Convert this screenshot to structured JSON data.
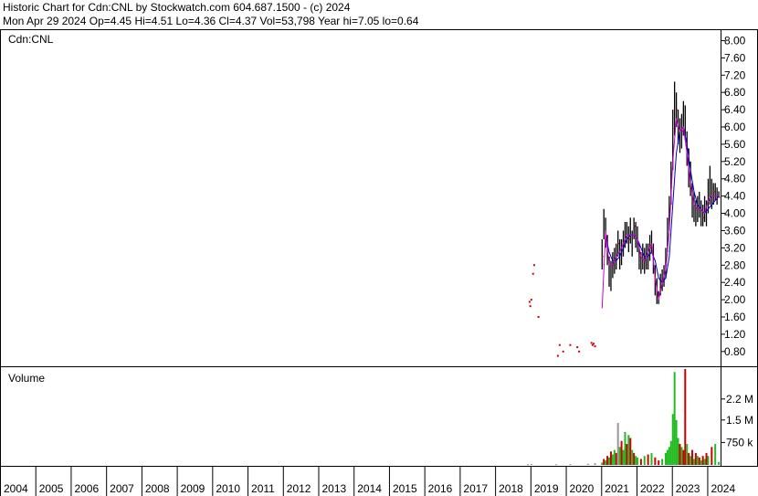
{
  "header": {
    "line1": "Historic Chart for Cdn:CNL by Stockwatch.com 604.687.1500 - (c) 2024",
    "line2": "Mon Apr 29 2024  Op=4.45  Hi=4.51  Lo=4.36  Cl=4.37  Vol=53,798  Year hi=7.05  lo=0.64"
  },
  "colors": {
    "price_bar": "#000000",
    "price_sparse": "#cc0000",
    "ma_short": "#cc00cc",
    "ma_long": "#0000cc",
    "vol_up": "#22bb22",
    "vol_down": "#cc0000",
    "vol_flat": "#999999",
    "grid": "#000000"
  },
  "chart_data": [
    {
      "type": "line",
      "title": "Cdn:CNL",
      "ylim": [
        0.5,
        8.2
      ],
      "y_ticks": [
        "8.00",
        "7.60",
        "7.20",
        "6.80",
        "6.40",
        "6.00",
        "5.60",
        "5.20",
        "4.80",
        "4.40",
        "4.00",
        "3.60",
        "3.20",
        "2.80",
        "2.40",
        "2.00",
        "1.60",
        "1.20",
        "0.80"
      ],
      "sparse_points": {
        "x": [
          2018.95,
          2018.97,
          2019.0,
          2019.05,
          2019.08,
          2019.2,
          2019.75,
          2019.8,
          2019.9,
          2020.1,
          2020.3,
          2020.35,
          2020.7,
          2020.73,
          2020.76,
          2020.8
        ],
        "y": [
          1.95,
          1.85,
          2.0,
          2.6,
          2.8,
          1.6,
          0.7,
          0.95,
          0.8,
          0.95,
          0.9,
          0.8,
          1.0,
          0.95,
          0.98,
          0.92
        ]
      },
      "price_series": {
        "x": [
          2021.0,
          2021.05,
          2021.1,
          2021.15,
          2021.2,
          2021.25,
          2021.3,
          2021.35,
          2021.4,
          2021.45,
          2021.5,
          2021.55,
          2021.6,
          2021.65,
          2021.7,
          2021.75,
          2021.8,
          2021.85,
          2021.9,
          2021.95,
          2022.0,
          2022.05,
          2022.1,
          2022.15,
          2022.2,
          2022.25,
          2022.3,
          2022.35,
          2022.4,
          2022.45,
          2022.5,
          2022.55,
          2022.6,
          2022.65,
          2022.7,
          2022.75,
          2022.8,
          2022.85,
          2022.9,
          2022.95,
          2023.0,
          2023.05,
          2023.1,
          2023.15,
          2023.2,
          2023.25,
          2023.3,
          2023.35,
          2023.4,
          2023.45,
          2023.5,
          2023.55,
          2023.6,
          2023.65,
          2023.7,
          2023.75,
          2023.8,
          2023.85,
          2023.9,
          2023.95,
          2024.0,
          2024.05,
          2024.1,
          2024.15,
          2024.2,
          2024.25,
          2024.3
        ],
        "close": [
          3.0,
          3.8,
          3.6,
          3.1,
          2.6,
          2.5,
          2.8,
          2.9,
          3.0,
          3.3,
          3.0,
          3.1,
          3.3,
          3.5,
          3.6,
          3.4,
          3.6,
          3.3,
          3.7,
          3.5,
          3.4,
          3.0,
          2.9,
          3.0,
          2.9,
          3.0,
          3.0,
          3.2,
          3.4,
          2.9,
          2.4,
          2.2,
          2.0,
          2.4,
          2.5,
          2.5,
          2.8,
          3.5,
          4.0,
          4.6,
          5.6,
          6.2,
          6.4,
          6.0,
          5.8,
          5.9,
          6.2,
          6.1,
          5.5,
          5.0,
          4.8,
          4.3,
          4.2,
          4.0,
          4.1,
          4.2,
          4.0,
          3.9,
          4.1,
          4.0,
          4.3,
          4.6,
          4.4,
          4.5,
          4.5,
          4.4,
          4.37
        ],
        "high": [
          3.4,
          4.1,
          3.9,
          3.5,
          3.0,
          2.9,
          3.1,
          3.2,
          3.3,
          3.6,
          3.4,
          3.4,
          3.6,
          3.8,
          3.8,
          3.7,
          3.9,
          3.6,
          3.9,
          3.8,
          3.7,
          3.3,
          3.1,
          3.3,
          3.2,
          3.3,
          3.3,
          3.5,
          3.6,
          3.3,
          2.8,
          2.5,
          2.2,
          2.6,
          2.7,
          2.8,
          3.2,
          3.9,
          4.4,
          5.2,
          6.4,
          7.05,
          6.8,
          6.4,
          6.2,
          6.3,
          6.6,
          6.5,
          5.9,
          5.5,
          5.2,
          4.7,
          4.5,
          4.3,
          4.4,
          4.5,
          4.3,
          4.2,
          4.4,
          4.3,
          4.8,
          5.1,
          4.8,
          4.7,
          4.7,
          4.6,
          4.51
        ],
        "low": [
          2.7,
          3.4,
          3.2,
          2.8,
          2.3,
          2.2,
          2.5,
          2.6,
          2.7,
          3.0,
          2.7,
          2.8,
          3.0,
          3.2,
          3.3,
          3.1,
          3.3,
          3.0,
          3.4,
          3.2,
          3.1,
          2.7,
          2.6,
          2.7,
          2.6,
          2.7,
          2.7,
          2.9,
          3.1,
          2.6,
          2.1,
          1.9,
          1.9,
          2.1,
          2.2,
          2.3,
          2.5,
          3.1,
          3.6,
          4.2,
          5.0,
          5.8,
          6.0,
          5.6,
          5.4,
          5.5,
          5.8,
          5.7,
          5.1,
          4.6,
          4.4,
          3.9,
          3.8,
          3.7,
          3.8,
          3.9,
          3.7,
          3.7,
          3.8,
          3.7,
          4.0,
          4.2,
          4.1,
          4.2,
          4.3,
          4.2,
          4.36
        ]
      },
      "ma_short": {
        "x": [
          2021.0,
          2021.1,
          2021.2,
          2021.3,
          2021.4,
          2021.5,
          2021.6,
          2021.7,
          2021.8,
          2021.9,
          2022.0,
          2022.1,
          2022.2,
          2022.3,
          2022.4,
          2022.5,
          2022.6,
          2022.7,
          2022.8,
          2022.9,
          2023.0,
          2023.1,
          2023.2,
          2023.3,
          2023.4,
          2023.5,
          2023.6,
          2023.7,
          2023.8,
          2023.9,
          2024.0,
          2024.1,
          2024.2,
          2024.3
        ],
        "y": [
          1.8,
          3.6,
          2.8,
          2.8,
          3.0,
          3.1,
          3.3,
          3.5,
          3.5,
          3.5,
          3.4,
          3.0,
          2.9,
          3.1,
          3.3,
          2.5,
          2.0,
          2.4,
          2.7,
          3.6,
          5.2,
          6.2,
          5.9,
          6.0,
          5.4,
          4.7,
          4.2,
          4.1,
          4.1,
          4.0,
          4.3,
          4.4,
          4.4,
          4.4
        ]
      },
      "ma_long": {
        "x": [
          2021.1,
          2021.2,
          2021.3,
          2021.4,
          2021.5,
          2021.6,
          2021.7,
          2021.8,
          2021.9,
          2022.0,
          2022.1,
          2022.2,
          2022.3,
          2022.4,
          2022.5,
          2022.6,
          2022.7,
          2022.8,
          2022.9,
          2023.0,
          2023.1,
          2023.2,
          2023.3,
          2023.4,
          2023.5,
          2023.6,
          2023.7,
          2023.8,
          2023.9,
          2024.0,
          2024.1,
          2024.2,
          2024.3
        ],
        "y": [
          3.5,
          3.1,
          2.9,
          2.9,
          3.0,
          3.2,
          3.4,
          3.5,
          3.5,
          3.4,
          3.2,
          3.0,
          3.0,
          3.1,
          2.9,
          2.5,
          2.4,
          2.5,
          3.0,
          4.2,
          5.4,
          5.9,
          6.0,
          5.6,
          5.0,
          4.5,
          4.2,
          4.1,
          4.0,
          4.1,
          4.2,
          4.3,
          4.4
        ]
      }
    },
    {
      "type": "bar",
      "title": "Volume",
      "ylim": [
        0,
        3200000
      ],
      "y_ticks": [
        "2.2 M",
        "1.5 M",
        "750 k"
      ],
      "y_tick_values": [
        2200000,
        1500000,
        750000
      ],
      "x": [
        2018.9,
        2019.0,
        2019.7,
        2020.1,
        2020.6,
        2020.8,
        2021.0,
        2021.05,
        2021.1,
        2021.15,
        2021.2,
        2021.25,
        2021.3,
        2021.35,
        2021.4,
        2021.45,
        2021.5,
        2021.55,
        2021.6,
        2021.65,
        2021.7,
        2021.75,
        2021.8,
        2021.85,
        2021.9,
        2021.95,
        2022.0,
        2022.1,
        2022.2,
        2022.3,
        2022.4,
        2022.5,
        2022.6,
        2022.7,
        2022.8,
        2022.85,
        2022.9,
        2022.95,
        2023.0,
        2023.05,
        2023.1,
        2023.15,
        2023.2,
        2023.25,
        2023.3,
        2023.35,
        2023.4,
        2023.45,
        2023.5,
        2023.55,
        2023.6,
        2023.65,
        2023.7,
        2023.75,
        2023.8,
        2023.85,
        2023.9,
        2023.95,
        2024.0,
        2024.1,
        2024.2,
        2024.3
      ],
      "values": [
        20000,
        30000,
        25000,
        30000,
        40000,
        60000,
        80000,
        200000,
        150000,
        300000,
        250000,
        450000,
        350000,
        500000,
        400000,
        1400000,
        600000,
        800000,
        500000,
        1100000,
        700000,
        1000000,
        900000,
        500000,
        400000,
        300000,
        250000,
        200000,
        300000,
        350000,
        400000,
        250000,
        150000,
        200000,
        400000,
        500000,
        600000,
        800000,
        1700000,
        3100000,
        1500000,
        900000,
        700000,
        600000,
        500000,
        3200000,
        700000,
        400000,
        300000,
        500000,
        200000,
        400000,
        300000,
        250000,
        150000,
        300000,
        200000,
        400000,
        300000,
        600000,
        700000,
        100000
      ],
      "direction": [
        "f",
        "f",
        "f",
        "f",
        "f",
        "f",
        "u",
        "d",
        "u",
        "d",
        "u",
        "d",
        "u",
        "u",
        "d",
        "f",
        "u",
        "d",
        "u",
        "u",
        "d",
        "u",
        "d",
        "u",
        "d",
        "u",
        "u",
        "d",
        "u",
        "d",
        "u",
        "d",
        "d",
        "u",
        "u",
        "u",
        "u",
        "u",
        "u",
        "u",
        "u",
        "u",
        "d",
        "u",
        "d",
        "d",
        "u",
        "d",
        "u",
        "d",
        "u",
        "d",
        "u",
        "d",
        "u",
        "d",
        "u",
        "d",
        "u",
        "d",
        "u",
        "u"
      ]
    }
  ],
  "x_axis": {
    "xlim": [
      2004.0,
      2024.35
    ],
    "labels": [
      "2004",
      "2005",
      "2006",
      "2007",
      "2008",
      "2009",
      "2010",
      "2011",
      "2012",
      "2013",
      "2014",
      "2015",
      "2016",
      "2017",
      "2018",
      "2019",
      "2020",
      "2021",
      "2022",
      "2023",
      "2024"
    ],
    "label_values": [
      2004,
      2005,
      2006,
      2007,
      2008,
      2009,
      2010,
      2011,
      2012,
      2013,
      2014,
      2015,
      2016,
      2017,
      2018,
      2019,
      2020,
      2021,
      2022,
      2023,
      2024
    ]
  }
}
